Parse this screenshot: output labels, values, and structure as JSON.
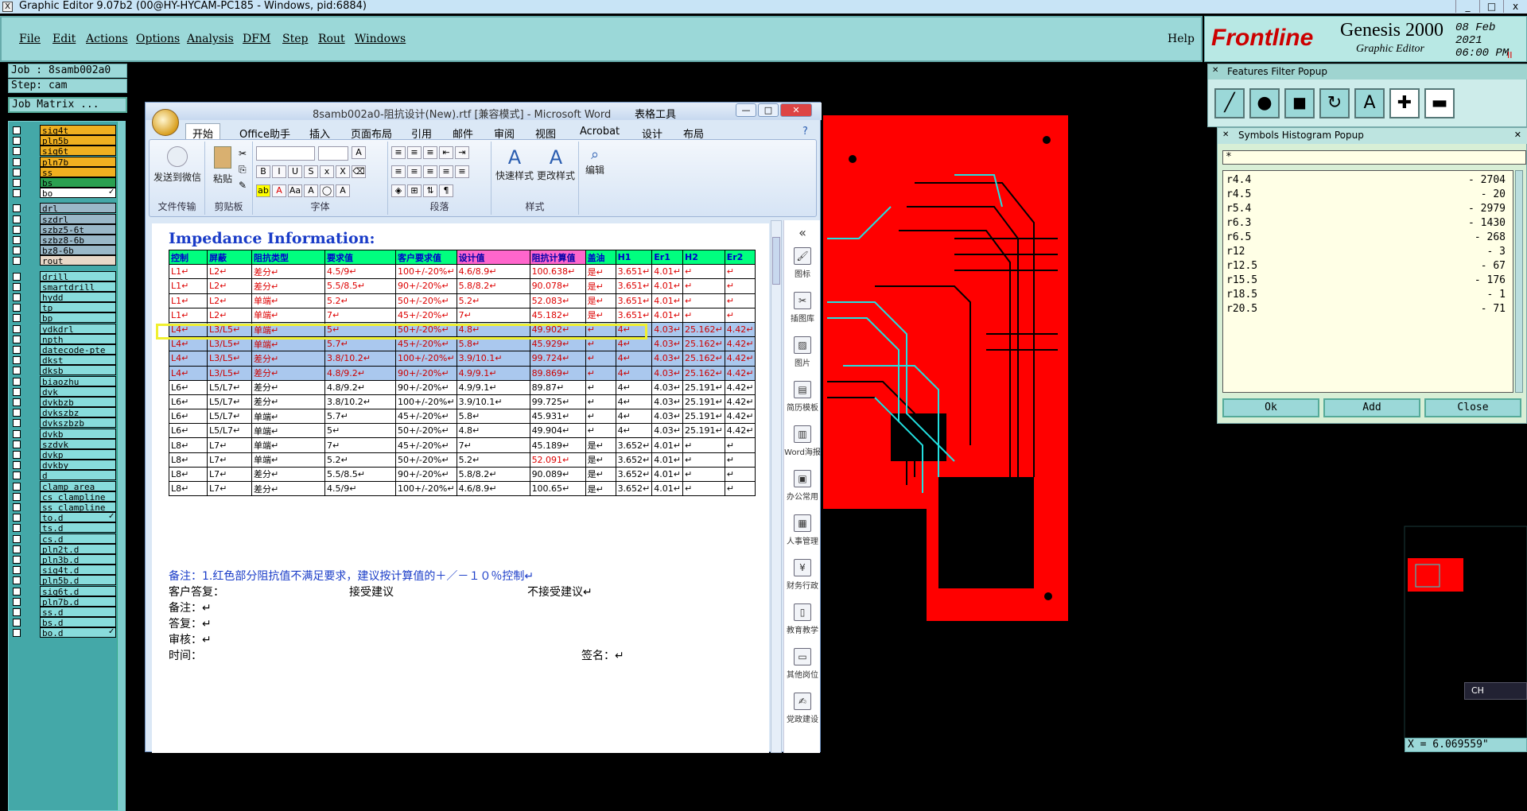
{
  "window": {
    "icon": "X",
    "title": "Graphic Editor 9.07b2 (00@HY-HYCAM-PC185 - Windows, pid:6884)",
    "min": "_",
    "max": "□",
    "close": "x"
  },
  "menu": {
    "items": [
      "File",
      "Edit",
      "Actions",
      "Options",
      "Analysis",
      "DFM",
      "Step",
      "Rout",
      "Windows"
    ],
    "help": "Help"
  },
  "brand": {
    "logo": "Frontline",
    "product": "Genesis 2000",
    "sub": "Graphic Editor",
    "date": "08 Feb 2021",
    "time": "06:00 PM",
    "pause": "II"
  },
  "job": {
    "job": "Job : 8samb002a0",
    "step": "Step: cam",
    "matrix": "Job Matrix ..."
  },
  "layers": [
    {
      "name": "sig4t",
      "color": "#f0b020"
    },
    {
      "name": "pln5b",
      "color": "#f0b020"
    },
    {
      "name": "sig6t",
      "color": "#f0b020"
    },
    {
      "name": "pln7b",
      "color": "#f0b020"
    },
    {
      "name": "ss",
      "color": "#f0b020"
    },
    {
      "name": "bs",
      "color": "#2aa050"
    },
    {
      "name": "bo",
      "color": "#ffffff",
      "mark": "✓"
    },
    {
      "name": "drl",
      "color": "#9ab8c8"
    },
    {
      "name": "szdrl",
      "color": "#9ab8c8"
    },
    {
      "name": "szbz5-6t",
      "color": "#9ab8c8"
    },
    {
      "name": "szbz8-6b",
      "color": "#9ab8c8"
    },
    {
      "name": "bz8-6b",
      "color": "#9ab8c8"
    },
    {
      "name": "rout",
      "color": "#e8d8c8"
    },
    {
      "name": "drill",
      "color": "#88dcdc"
    },
    {
      "name": "smartdrill",
      "color": "#88dcdc"
    },
    {
      "name": "hydd",
      "color": "#88dcdc"
    },
    {
      "name": "tp",
      "color": "#88dcdc"
    },
    {
      "name": "bp",
      "color": "#88dcdc"
    },
    {
      "name": "ydkdrl",
      "color": "#88dcdc"
    },
    {
      "name": "npth",
      "color": "#88dcdc"
    },
    {
      "name": "datecode-pte",
      "color": "#88dcdc"
    },
    {
      "name": "dkst",
      "color": "#88dcdc"
    },
    {
      "name": "dksb",
      "color": "#88dcdc"
    },
    {
      "name": "biaozhu",
      "color": "#88dcdc"
    },
    {
      "name": "dvk",
      "color": "#88dcdc"
    },
    {
      "name": "dvkbzb",
      "color": "#88dcdc"
    },
    {
      "name": "dvkszbz",
      "color": "#88dcdc"
    },
    {
      "name": "dvkszbzb",
      "color": "#88dcdc"
    },
    {
      "name": "dvkb",
      "color": "#88dcdc"
    },
    {
      "name": "szdvk",
      "color": "#88dcdc"
    },
    {
      "name": "dvkp",
      "color": "#88dcdc"
    },
    {
      "name": "dvkby",
      "color": "#88dcdc"
    },
    {
      "name": "d",
      "color": "#88dcdc"
    },
    {
      "name": "clamp_area",
      "color": "#88dcdc"
    },
    {
      "name": "cs_clampline",
      "color": "#88dcdc"
    },
    {
      "name": "ss_clampline",
      "color": "#88dcdc"
    },
    {
      "name": "to.d",
      "color": "#88dcdc",
      "mark": "✓"
    },
    {
      "name": "ts.d",
      "color": "#88dcdc"
    },
    {
      "name": "cs.d",
      "color": "#88dcdc"
    },
    {
      "name": "pln2t.d",
      "color": "#88dcdc"
    },
    {
      "name": "pln3b.d",
      "color": "#88dcdc"
    },
    {
      "name": "sig4t.d",
      "color": "#88dcdc"
    },
    {
      "name": "pln5b.d",
      "color": "#88dcdc"
    },
    {
      "name": "sig6t.d",
      "color": "#88dcdc"
    },
    {
      "name": "pln7b.d",
      "color": "#88dcdc"
    },
    {
      "name": "ss.d",
      "color": "#88dcdc"
    },
    {
      "name": "bs.d",
      "color": "#88dcdc"
    },
    {
      "name": "bo.d",
      "color": "#88dcdc",
      "mark": "✓"
    }
  ],
  "word": {
    "title": "8samb002a0-阻抗设计(New).rtf [兼容模式] - Microsoft Word",
    "tools": "表格工具",
    "tabs": [
      "开始",
      "Office助手",
      "插入",
      "页面布局",
      "引用",
      "邮件",
      "审阅",
      "视图",
      "Acrobat",
      "设计",
      "布局"
    ],
    "ribbon": {
      "send": "发送到微信",
      "paste": "粘贴",
      "quick_styles": "快速样式",
      "change_styles": "更改样式",
      "edit": "编辑",
      "groups": [
        "文件传输",
        "剪贴板",
        "字体",
        "段落",
        "样式"
      ]
    },
    "sidebar": [
      "图标",
      "插图库",
      "图片",
      "简历模板",
      "Word海报",
      "办公常用",
      "人事管理",
      "财务行政",
      "教育教学",
      "其他岗位",
      "党政建设"
    ],
    "doc_title": "Impedance Information:",
    "headers": [
      "控制",
      "屏蔽",
      "阻抗类型",
      "要求值",
      "客户要求值",
      "设计值",
      "阻抗计算值",
      "盖油",
      "H1",
      "Er1",
      "H2",
      "Er2"
    ],
    "rows": [
      {
        "c": [
          "L1↵",
          "L2↵",
          "差分↵",
          "4.5/9↵",
          "100+/-20%↵",
          "4.6/8.9↵",
          "100.638↵",
          "是↵",
          "3.651↵",
          "4.01↵",
          "↵",
          "↵"
        ],
        "style": "red"
      },
      {
        "c": [
          "L1↵",
          "L2↵",
          "差分↵",
          "5.5/8.5↵",
          "90+/-20%↵",
          "5.8/8.2↵",
          "90.078↵",
          "是↵",
          "3.651↵",
          "4.01↵",
          "↵",
          "↵"
        ],
        "style": "red"
      },
      {
        "c": [
          "L1↵",
          "L2↵",
          "单端↵",
          "5.2↵",
          "50+/-20%↵",
          "5.2↵",
          "52.083↵",
          "是↵",
          "3.651↵",
          "4.01↵",
          "↵",
          "↵"
        ],
        "style": "red"
      },
      {
        "c": [
          "L1↵",
          "L2↵",
          "单端↵",
          "7↵",
          "45+/-20%↵",
          "7↵",
          "45.182↵",
          "是↵",
          "3.651↵",
          "4.01↵",
          "↵",
          "↵"
        ],
        "style": "red"
      },
      {
        "c": [
          "L4↵",
          "L3/L5↵",
          "单端↵",
          "5↵",
          "50+/-20%↵",
          "4.8↵",
          "49.902↵",
          "↵",
          "4↵",
          "4.03↵",
          "25.162↵",
          "4.42↵"
        ],
        "style": "sel"
      },
      {
        "c": [
          "L4↵",
          "L3/L5↵",
          "单端↵",
          "5.7↵",
          "45+/-20%↵",
          "5.8↵",
          "45.929↵",
          "↵",
          "4↵",
          "4.03↵",
          "25.162↵",
          "4.42↵"
        ],
        "style": "sel"
      },
      {
        "c": [
          "L4↵",
          "L3/L5↵",
          "差分↵",
          "3.8/10.2↵",
          "100+/-20%↵",
          "3.9/10.1↵",
          "99.724↵",
          "↵",
          "4↵",
          "4.03↵",
          "25.162↵",
          "4.42↵"
        ],
        "style": "sel"
      },
      {
        "c": [
          "L4↵",
          "L3/L5↵",
          "差分↵",
          "4.8/9.2↵",
          "90+/-20%↵",
          "4.9/9.1↵",
          "89.869↵",
          "↵",
          "4↵",
          "4.03↵",
          "25.162↵",
          "4.42↵"
        ],
        "style": "sel"
      },
      {
        "c": [
          "L6↵",
          "L5/L7↵",
          "差分↵",
          "4.8/9.2↵",
          "90+/-20%↵",
          "4.9/9.1↵",
          "89.87↵",
          "↵",
          "4↵",
          "4.03↵",
          "25.191↵",
          "4.42↵"
        ],
        "style": ""
      },
      {
        "c": [
          "L6↵",
          "L5/L7↵",
          "差分↵",
          "3.8/10.2↵",
          "100+/-20%↵",
          "3.9/10.1↵",
          "99.725↵",
          "↵",
          "4↵",
          "4.03↵",
          "25.191↵",
          "4.42↵"
        ],
        "style": ""
      },
      {
        "c": [
          "L6↵",
          "L5/L7↵",
          "单端↵",
          "5.7↵",
          "45+/-20%↵",
          "5.8↵",
          "45.931↵",
          "↵",
          "4↵",
          "4.03↵",
          "25.191↵",
          "4.42↵"
        ],
        "style": ""
      },
      {
        "c": [
          "L6↵",
          "L5/L7↵",
          "单端↵",
          "5↵",
          "50+/-20%↵",
          "4.8↵",
          "49.904↵",
          "↵",
          "4↵",
          "4.03↵",
          "25.191↵",
          "4.42↵"
        ],
        "style": ""
      },
      {
        "c": [
          "L8↵",
          "L7↵",
          "单端↵",
          "7↵",
          "45+/-20%↵",
          "7↵",
          "45.189↵",
          "是↵",
          "3.652↵",
          "4.01↵",
          "↵",
          "↵"
        ],
        "style": ""
      },
      {
        "c": [
          "L8↵",
          "L7↵",
          "单端↵",
          "5.2↵",
          "50+/-20%↵",
          "5.2↵",
          "52.091↵",
          "是↵",
          "3.652↵",
          "4.01↵",
          "↵",
          "↵"
        ],
        "style": "c6red"
      },
      {
        "c": [
          "L8↵",
          "L7↵",
          "差分↵",
          "5.5/8.5↵",
          "90+/-20%↵",
          "5.8/8.2↵",
          "90.089↵",
          "是↵",
          "3.652↵",
          "4.01↵",
          "↵",
          "↵"
        ],
        "style": ""
      },
      {
        "c": [
          "L8↵",
          "L7↵",
          "差分↵",
          "4.5/9↵",
          "100+/-20%↵",
          "4.6/8.9↵",
          "100.65↵",
          "是↵",
          "3.652↵",
          "4.01↵",
          "↵",
          "↵"
        ],
        "style": ""
      }
    ],
    "note1": "备注：1.红色部分阻抗值不满足要求，建议按计算值的＋／－１０％控制↵",
    "reply": "客户答复：",
    "accept": "接受建议",
    "reject": "不接受建议↵",
    "note2": "备注：↵",
    "answer": "答复：↵",
    "review": "审核：↵",
    "time": "时间：",
    "sign": "签名：↵"
  },
  "features_filter": {
    "title": "Features Filter Popup",
    "tools": [
      "line-tool",
      "pad-tool",
      "surface-tool",
      "arc-tool",
      "text-tool",
      "plus-tool",
      "minus-tool"
    ]
  },
  "histogram": {
    "title": "Symbols Histogram Popup",
    "filter": "*",
    "rows": [
      {
        "sym": "r4.4",
        "count": "- 2704"
      },
      {
        "sym": "r4.5",
        "count": "- 20"
      },
      {
        "sym": "r5.4",
        "count": "- 2979"
      },
      {
        "sym": "r6.3",
        "count": "- 1430"
      },
      {
        "sym": "r6.5",
        "count": "- 268"
      },
      {
        "sym": "r12",
        "count": "- 3"
      },
      {
        "sym": "r12.5",
        "count": "- 67"
      },
      {
        "sym": "r15.5",
        "count": "- 176"
      },
      {
        "sym": "r18.5",
        "count": "- 1"
      },
      {
        "sym": "r20.5",
        "count": "- 71"
      }
    ],
    "ok": "Ok",
    "add": "Add",
    "close": "Close"
  },
  "ime": "CH",
  "readout": "X = 6.069559\""
}
